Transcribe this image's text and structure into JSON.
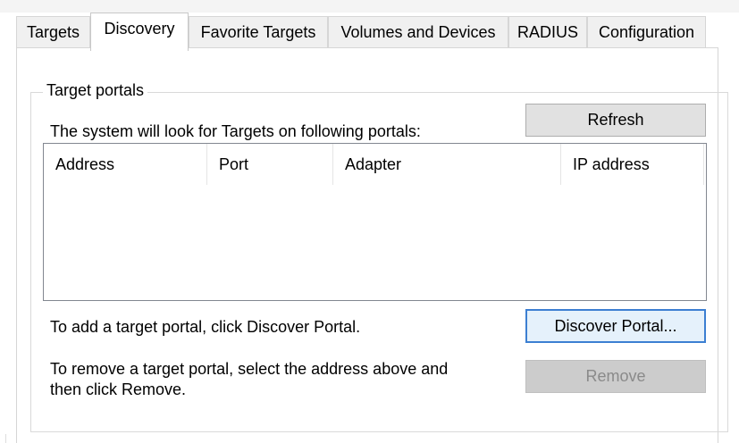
{
  "tabs": [
    {
      "label": "Targets",
      "active": false
    },
    {
      "label": "Discovery",
      "active": true
    },
    {
      "label": "Favorite Targets",
      "active": false
    },
    {
      "label": "Volumes and Devices",
      "active": false
    },
    {
      "label": "RADIUS",
      "active": false
    },
    {
      "label": "Configuration",
      "active": false
    }
  ],
  "target_portals": {
    "group_title": "Target portals",
    "description": "The system will look for Targets on following portals:",
    "refresh_label": "Refresh",
    "columns": [
      "Address",
      "Port",
      "Adapter",
      "IP address"
    ],
    "rows": [],
    "add_hint": "To add a target portal, click Discover Portal.",
    "discover_label": "Discover Portal...",
    "remove_hint_line1": "To remove a target portal, select the address above and",
    "remove_hint_line2": "then click Remove.",
    "remove_label": "Remove"
  }
}
